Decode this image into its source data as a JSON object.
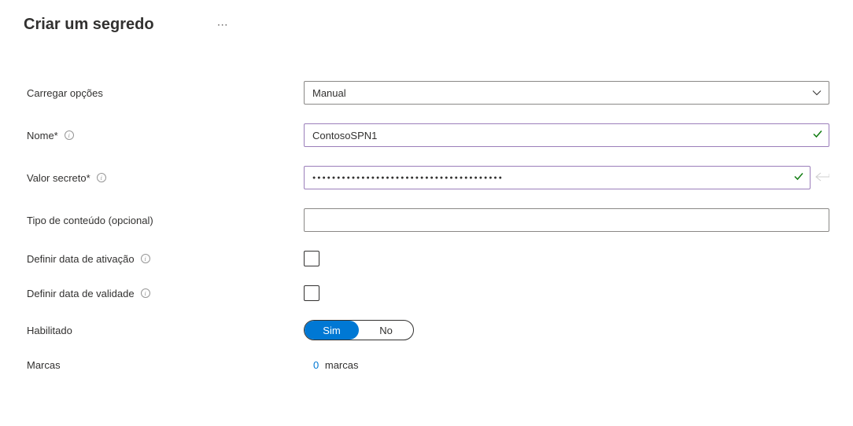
{
  "header": {
    "title": "Criar um segredo"
  },
  "form": {
    "upload_options": {
      "label": "Carregar opções",
      "value": "Manual"
    },
    "name": {
      "label": "Nome*",
      "value": "ContosoSPN1"
    },
    "secret_value": {
      "label": "Valor secreto*",
      "value": "●●●●●●●●●●●●●●●●●●●●●●●●●●●●●●●●●●●●●●●"
    },
    "content_type": {
      "label": "Tipo de conteúdo (opcional)",
      "value": ""
    },
    "activation_date": {
      "label": "Definir data de ativação"
    },
    "expiration_date": {
      "label": "Definir data de validade"
    },
    "enabled": {
      "label": "Habilitado",
      "yes": "Sim",
      "no": "No"
    },
    "tags": {
      "label": "Marcas",
      "count": "0",
      "word": "marcas"
    }
  }
}
